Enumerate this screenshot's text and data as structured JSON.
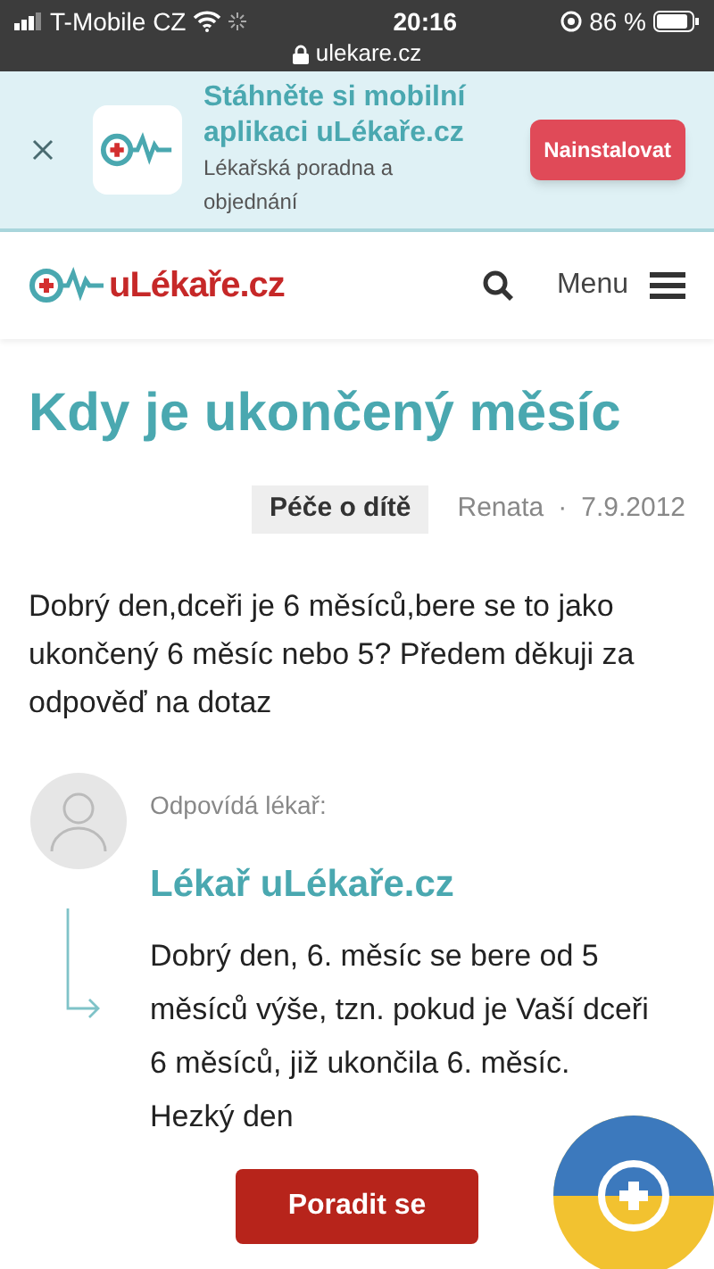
{
  "status_bar": {
    "carrier": "T-Mobile CZ",
    "time": "20:16",
    "battery": "86 %",
    "url": "ulekare.cz"
  },
  "app_banner": {
    "title": "Stáhněte si mobilní aplikaci uLékaře.cz",
    "subtitle": "Lékařská poradna a objednání",
    "button": "Nainstalovat"
  },
  "header": {
    "logo": "uLékaře.cz",
    "menu": "Menu"
  },
  "question": {
    "title": "Kdy je ukončený měsíc",
    "category": "Péče o dítě",
    "author": "Renata",
    "separator": "·",
    "date": "7.9.2012",
    "text": "Dobrý den,dceři je 6 měsíců,bere se to jako ukončený 6 měsíc nebo 5? Předem děkuji za odpověď na dotaz"
  },
  "answer": {
    "label": "Odpovídá lékař:",
    "doctor": "Lékař uLékaře.cz",
    "text": "Dobrý den, 6. měsíc se bere od 5 měsíců výše, tzn. pokud je Vaší dceři 6 měsíců, již ukončila 6. měsíc. Hezký den"
  },
  "cta_button": "Poradit se"
}
